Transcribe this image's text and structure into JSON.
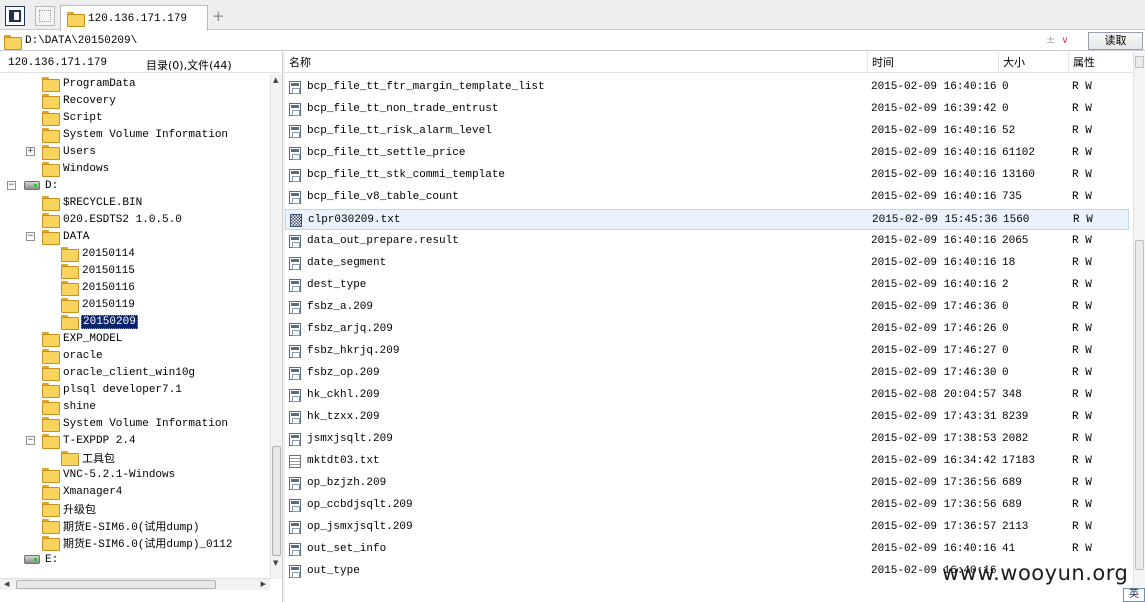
{
  "tabbar": {
    "active_tab_label": "120.136.171.179",
    "add_tab_label": "+"
  },
  "address": {
    "path": "D:\\DATA\\20150209\\",
    "read_label": "读取",
    "plus_minus_glyph": "±",
    "dropdown_glyph": "∨"
  },
  "left_header": {
    "host": "120.136.171.179",
    "counts": "目录(0),文件(44)"
  },
  "tree": [
    {
      "label": "ProgramData",
      "icon": "folder-icon"
    },
    {
      "label": "Recovery",
      "icon": "folder-icon"
    },
    {
      "label": "Script",
      "icon": "folder-icon"
    },
    {
      "label": "System Volume Information",
      "icon": "folder-icon"
    },
    {
      "label": "Users",
      "icon": "folder-icon",
      "expander": "+"
    },
    {
      "label": "Windows",
      "icon": "folder-icon"
    },
    {
      "label": "D:",
      "icon": "drive-icon",
      "expander": "−"
    },
    {
      "label": "$RECYCLE.BIN",
      "icon": "folder-icon"
    },
    {
      "label": "020.ESDTS2 1.0.5.0",
      "icon": "folder-icon"
    },
    {
      "label": "DATA",
      "icon": "folder-icon",
      "expander": "−"
    },
    {
      "label": "20150114",
      "icon": "folder-icon"
    },
    {
      "label": "20150115",
      "icon": "folder-icon"
    },
    {
      "label": "20150116",
      "icon": "folder-icon"
    },
    {
      "label": "20150119",
      "icon": "folder-icon"
    },
    {
      "label": "20150209",
      "icon": "folder-icon",
      "selected": true
    },
    {
      "label": "EXP_MODEL",
      "icon": "folder-icon"
    },
    {
      "label": "oracle",
      "icon": "folder-icon"
    },
    {
      "label": "oracle_client_win10g",
      "icon": "folder-icon"
    },
    {
      "label": "plsql developer7.1",
      "icon": "folder-icon"
    },
    {
      "label": "shine",
      "icon": "folder-icon"
    },
    {
      "label": "System Volume Information",
      "icon": "folder-icon"
    },
    {
      "label": "T-EXPDP 2.4",
      "icon": "folder-icon",
      "expander": "−"
    },
    {
      "label": "工具包",
      "icon": "folder-icon"
    },
    {
      "label": "VNC-5.2.1-Windows",
      "icon": "folder-icon"
    },
    {
      "label": "Xmanager4",
      "icon": "folder-icon"
    },
    {
      "label": "升级包",
      "icon": "folder-icon"
    },
    {
      "label": "期货E-SIM6.0(试用dump)",
      "icon": "folder-icon"
    },
    {
      "label": "期货E-SIM6.0(试用dump)_0112",
      "icon": "folder-icon"
    },
    {
      "label": "E:",
      "icon": "drive-icon"
    }
  ],
  "columns": {
    "name": "名称",
    "time": "时间",
    "size": "大小",
    "attr": "属性"
  },
  "files": [
    {
      "name": "bcp_file_tt_ftr_margin_template_list",
      "time": "2015-02-09 16:40:16",
      "size": "0",
      "attr": "R W",
      "icon": "file-icon"
    },
    {
      "name": "bcp_file_tt_non_trade_entrust",
      "time": "2015-02-09 16:39:42",
      "size": "0",
      "attr": "R W",
      "icon": "file-icon"
    },
    {
      "name": "bcp_file_tt_risk_alarm_level",
      "time": "2015-02-09 16:40:16",
      "size": "52",
      "attr": "R W",
      "icon": "file-icon"
    },
    {
      "name": "bcp_file_tt_settle_price",
      "time": "2015-02-09 16:40:16",
      "size": "61102",
      "attr": "R W",
      "icon": "file-icon"
    },
    {
      "name": "bcp_file_tt_stk_commi_template",
      "time": "2015-02-09 16:40:16",
      "size": "13160",
      "attr": "R W",
      "icon": "file-icon"
    },
    {
      "name": "bcp_file_v8_table_count",
      "time": "2015-02-09 16:40:16",
      "size": "735",
      "attr": "R W",
      "icon": "file-icon"
    },
    {
      "name": "clpr030209.txt",
      "time": "2015-02-09 15:45:36",
      "size": "1560",
      "attr": "R W",
      "icon": "checker-file-icon",
      "selected": true
    },
    {
      "name": "data_out_prepare.result",
      "time": "2015-02-09 16:40:16",
      "size": "2065",
      "attr": "R W",
      "icon": "file-icon"
    },
    {
      "name": "date_segment",
      "time": "2015-02-09 16:40:16",
      "size": "18",
      "attr": "R W",
      "icon": "file-icon"
    },
    {
      "name": "dest_type",
      "time": "2015-02-09 16:40:16",
      "size": "2",
      "attr": "R W",
      "icon": "file-icon"
    },
    {
      "name": "fsbz_a.209",
      "time": "2015-02-09 17:46:36",
      "size": "0",
      "attr": "R W",
      "icon": "file-icon"
    },
    {
      "name": "fsbz_arjq.209",
      "time": "2015-02-09 17:46:26",
      "size": "0",
      "attr": "R W",
      "icon": "file-icon"
    },
    {
      "name": "fsbz_hkrjq.209",
      "time": "2015-02-09 17:46:27",
      "size": "0",
      "attr": "R W",
      "icon": "file-icon"
    },
    {
      "name": "fsbz_op.209",
      "time": "2015-02-09 17:46:30",
      "size": "0",
      "attr": "R W",
      "icon": "file-icon"
    },
    {
      "name": "hk_ckhl.209",
      "time": "2015-02-08 20:04:57",
      "size": "348",
      "attr": "R W",
      "icon": "file-icon"
    },
    {
      "name": "hk_tzxx.209",
      "time": "2015-02-09 17:43:31",
      "size": "8239",
      "attr": "R W",
      "icon": "file-icon"
    },
    {
      "name": "jsmxjsqlt.209",
      "time": "2015-02-09 17:38:53",
      "size": "2082",
      "attr": "R W",
      "icon": "file-icon"
    },
    {
      "name": "mktdt03.txt",
      "time": "2015-02-09 16:34:42",
      "size": "17183",
      "attr": "R W",
      "icon": "text-file-icon"
    },
    {
      "name": "op_bzjzh.209",
      "time": "2015-02-09 17:36:56",
      "size": "689",
      "attr": "R W",
      "icon": "file-icon"
    },
    {
      "name": "op_ccbdjsqlt.209",
      "time": "2015-02-09 17:36:56",
      "size": "689",
      "attr": "R W",
      "icon": "file-icon"
    },
    {
      "name": "op_jsmxjsqlt.209",
      "time": "2015-02-09 17:36:57",
      "size": "2113",
      "attr": "R W",
      "icon": "file-icon"
    },
    {
      "name": "out_set_info",
      "time": "2015-02-09 16:40:16",
      "size": "41",
      "attr": "R W",
      "icon": "file-icon"
    },
    {
      "name": "out_type",
      "time": "2015-02-09 16:40:16",
      "size": "",
      "attr": "",
      "icon": "file-icon"
    }
  ],
  "watermark": "www.wooyun.org",
  "corner_glyph": "英",
  "colors": {
    "selection": "#0a246a",
    "row_highlight": "#eaf2fb",
    "folder": "#f8d35e"
  }
}
